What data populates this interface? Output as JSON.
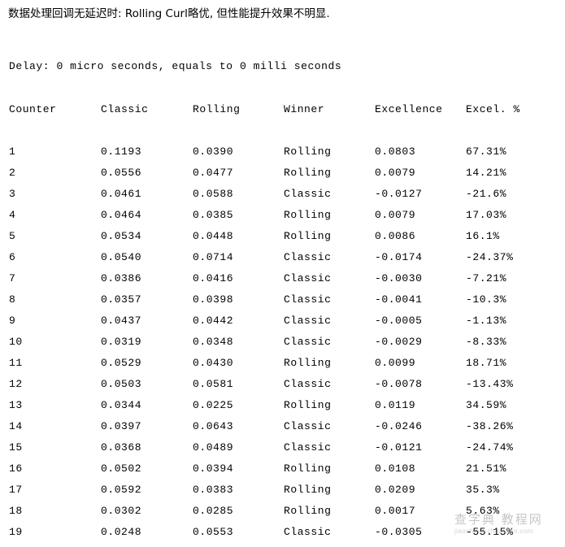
{
  "heading": "数据处理回调无延迟时: Rolling Curl略优, 但性能提升效果不明显.",
  "rule_dashes": "----------------------------------------------------------------------------------------------------",
  "delay": {
    "text": "Delay: 0 micro seconds, equals to 0 milli seconds"
  },
  "table": {
    "headers": {
      "counter": "Counter",
      "classic": "Classic",
      "rolling": "Rolling",
      "winner": "Winner",
      "excellence": "Excellence",
      "percent": "Excel. %"
    },
    "rows": [
      {
        "counter": "1",
        "classic": "0.1193",
        "rolling": "0.0390",
        "winner": "Rolling",
        "excellence": "0.0803",
        "percent": "67.31%"
      },
      {
        "counter": "2",
        "classic": "0.0556",
        "rolling": "0.0477",
        "winner": "Rolling",
        "excellence": "0.0079",
        "percent": "14.21%"
      },
      {
        "counter": "3",
        "classic": "0.0461",
        "rolling": "0.0588",
        "winner": "Classic",
        "excellence": "-0.0127",
        "percent": "-21.6%"
      },
      {
        "counter": "4",
        "classic": "0.0464",
        "rolling": "0.0385",
        "winner": "Rolling",
        "excellence": "0.0079",
        "percent": "17.03%"
      },
      {
        "counter": "5",
        "classic": "0.0534",
        "rolling": "0.0448",
        "winner": "Rolling",
        "excellence": "0.0086",
        "percent": "16.1%"
      },
      {
        "counter": "6",
        "classic": "0.0540",
        "rolling": "0.0714",
        "winner": "Classic",
        "excellence": "-0.0174",
        "percent": "-24.37%"
      },
      {
        "counter": "7",
        "classic": "0.0386",
        "rolling": "0.0416",
        "winner": "Classic",
        "excellence": "-0.0030",
        "percent": "-7.21%"
      },
      {
        "counter": "8",
        "classic": "0.0357",
        "rolling": "0.0398",
        "winner": "Classic",
        "excellence": "-0.0041",
        "percent": "-10.3%"
      },
      {
        "counter": "9",
        "classic": "0.0437",
        "rolling": "0.0442",
        "winner": "Classic",
        "excellence": "-0.0005",
        "percent": "-1.13%"
      },
      {
        "counter": "10",
        "classic": "0.0319",
        "rolling": "0.0348",
        "winner": "Classic",
        "excellence": "-0.0029",
        "percent": "-8.33%"
      },
      {
        "counter": "11",
        "classic": "0.0529",
        "rolling": "0.0430",
        "winner": "Rolling",
        "excellence": "0.0099",
        "percent": "18.71%"
      },
      {
        "counter": "12",
        "classic": "0.0503",
        "rolling": "0.0581",
        "winner": "Classic",
        "excellence": "-0.0078",
        "percent": "-13.43%"
      },
      {
        "counter": "13",
        "classic": "0.0344",
        "rolling": "0.0225",
        "winner": "Rolling",
        "excellence": "0.0119",
        "percent": "34.59%"
      },
      {
        "counter": "14",
        "classic": "0.0397",
        "rolling": "0.0643",
        "winner": "Classic",
        "excellence": "-0.0246",
        "percent": "-38.26%"
      },
      {
        "counter": "15",
        "classic": "0.0368",
        "rolling": "0.0489",
        "winner": "Classic",
        "excellence": "-0.0121",
        "percent": "-24.74%"
      },
      {
        "counter": "16",
        "classic": "0.0502",
        "rolling": "0.0394",
        "winner": "Rolling",
        "excellence": "0.0108",
        "percent": "21.51%"
      },
      {
        "counter": "17",
        "classic": "0.0592",
        "rolling": "0.0383",
        "winner": "Rolling",
        "excellence": "0.0209",
        "percent": "35.3%"
      },
      {
        "counter": "18",
        "classic": "0.0302",
        "rolling": "0.0285",
        "winner": "Rolling",
        "excellence": "0.0017",
        "percent": "5.63%"
      },
      {
        "counter": "19",
        "classic": "0.0248",
        "rolling": "0.0553",
        "winner": "Classic",
        "excellence": "-0.0305",
        "percent": "-55.15%"
      }
    ]
  },
  "watermark": {
    "main": "查字典 教程网",
    "url": "jiaocheng.chazidian.com"
  }
}
